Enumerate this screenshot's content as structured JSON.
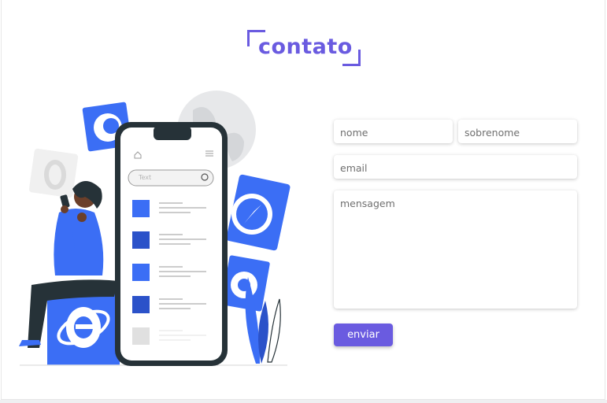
{
  "title": "contato",
  "form": {
    "first_name_placeholder": "nome",
    "last_name_placeholder": "sobrenome",
    "email_placeholder": "email",
    "message_placeholder": "mensagem",
    "submit_label": "enviar"
  },
  "phone_search_placeholder": "Text",
  "colors": {
    "accent": "#6a5be0",
    "illustration_blue": "#3b6ef5",
    "dark": "#263238"
  },
  "icons": [
    "firefox-icon",
    "opera-icon",
    "safari-icon",
    "chrome-icon",
    "internet-explorer-icon",
    "home-icon",
    "menu-icon",
    "search-icon"
  ]
}
